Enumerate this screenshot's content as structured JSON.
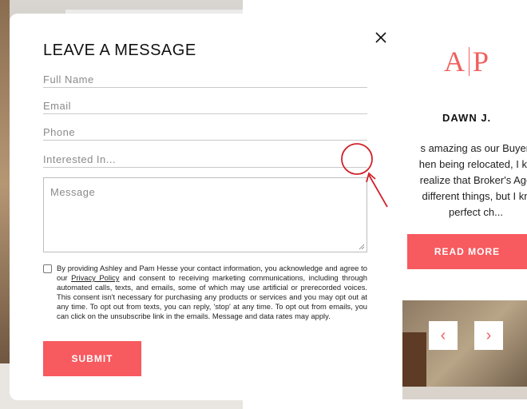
{
  "modal": {
    "title": "LEAVE A MESSAGE",
    "fields": {
      "full_name_placeholder": "Full Name",
      "email_placeholder": "Email",
      "phone_placeholder": "Phone",
      "interested_placeholder": "Interested In...",
      "message_placeholder": "Message"
    },
    "consent": {
      "before_link": "By providing Ashley and Pam Hesse your contact information, you acknowledge and agree to our ",
      "link": "Privacy Policy",
      "after_link": " and consent to receiving marketing communications, including through automated calls, texts, and emails, some of which may use artificial or prerecorded voices. This consent isn't necessary for purchasing any products or services and you may opt out at any time. To opt out from texts, you can reply, 'stop' at any time. To opt out from emails, you can click on the unsubscribe link in the emails. Message and data rates may apply."
    },
    "submit_label": "SUBMIT"
  },
  "background": {
    "logo_left": "A",
    "logo_right": "P",
    "reviewer": "DAWN J.",
    "quote_lines": [
      "s amazing as our Buyer'",
      "hen being relocated, I kn",
      "realize that Broker's Age",
      "different things, but I kn",
      "perfect ch..."
    ],
    "read_more_label": "READ MORE",
    "prev_glyph": "‹",
    "next_glyph": "›"
  },
  "colors": {
    "accent": "#f75a5f",
    "annotation": "#d0222a"
  }
}
